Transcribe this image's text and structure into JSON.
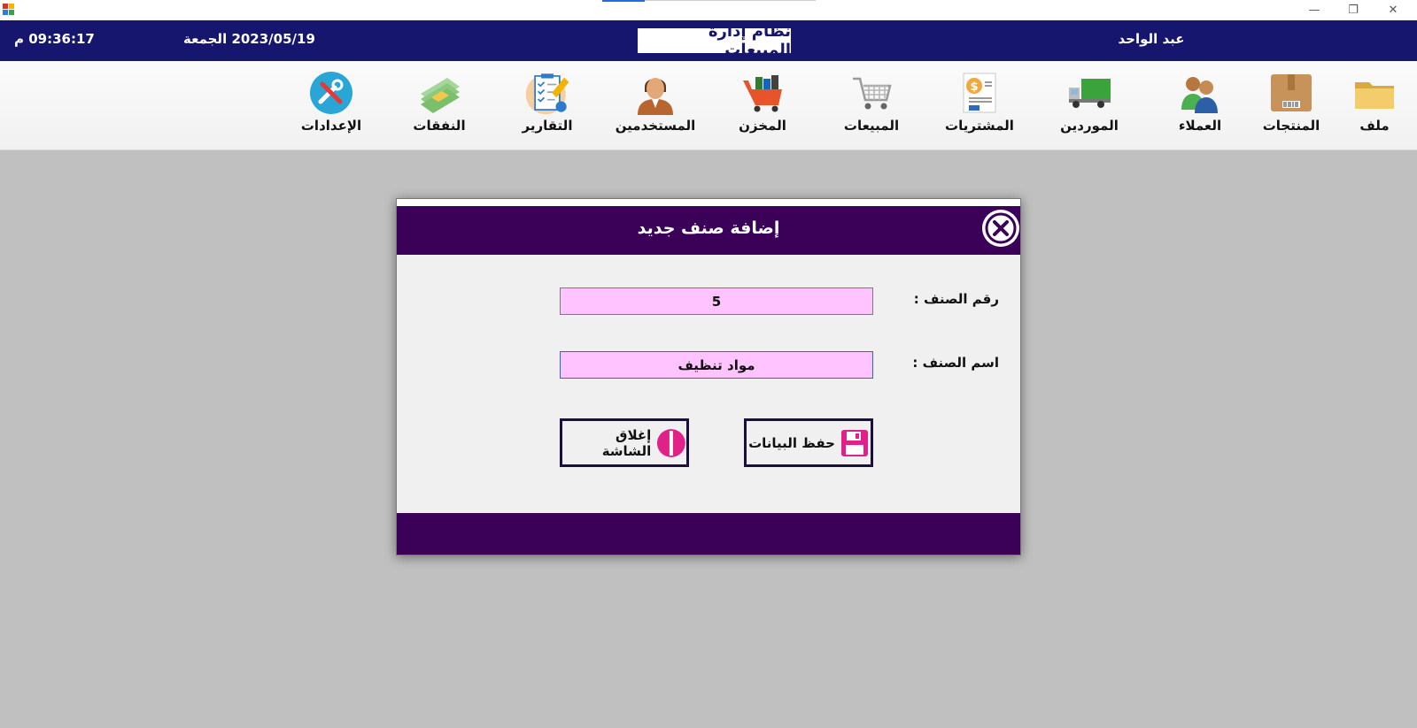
{
  "window": {
    "minimize_glyph": "—",
    "maximize_glyph": "❐",
    "close_glyph": "✕"
  },
  "header": {
    "clock": "09:36:17 م",
    "date": "2023/05/19  الجمعة",
    "app_title": "نظام إدارة المبيعات",
    "username": "عبد الواحد"
  },
  "toolbar": {
    "items": [
      {
        "label": "ملف",
        "icon": "folder-icon"
      },
      {
        "label": "المنتجات",
        "icon": "product-box-icon"
      },
      {
        "label": "العملاء",
        "icon": "customers-icon"
      },
      {
        "label": "الموردين",
        "icon": "truck-icon"
      },
      {
        "label": "المشتريات",
        "icon": "purchase-invoice-icon"
      },
      {
        "label": "المبيعات",
        "icon": "shopping-cart-icon"
      },
      {
        "label": "المخزن",
        "icon": "warehouse-cart-icon"
      },
      {
        "label": "المستخدمين",
        "icon": "user-icon"
      },
      {
        "label": "التقارير",
        "icon": "clipboard-report-icon"
      },
      {
        "label": "النفقات",
        "icon": "money-stack-icon"
      },
      {
        "label": "الإعدادات",
        "icon": "settings-tools-icon"
      }
    ]
  },
  "dialog": {
    "title": "إضافة صنف جديد",
    "fields": {
      "item_number_label": "رقم الصنف :",
      "item_number_value": "5",
      "item_name_label": "اسم الصنف :",
      "item_name_value": "مواد تنظيف"
    },
    "buttons": {
      "save_label": "حفظ البيانات",
      "close_label": "إغلاق الشاشة"
    },
    "colors": {
      "header": "#3b0058",
      "input_bg": "#ffc4ff",
      "accent_pink": "#e0218a"
    }
  }
}
